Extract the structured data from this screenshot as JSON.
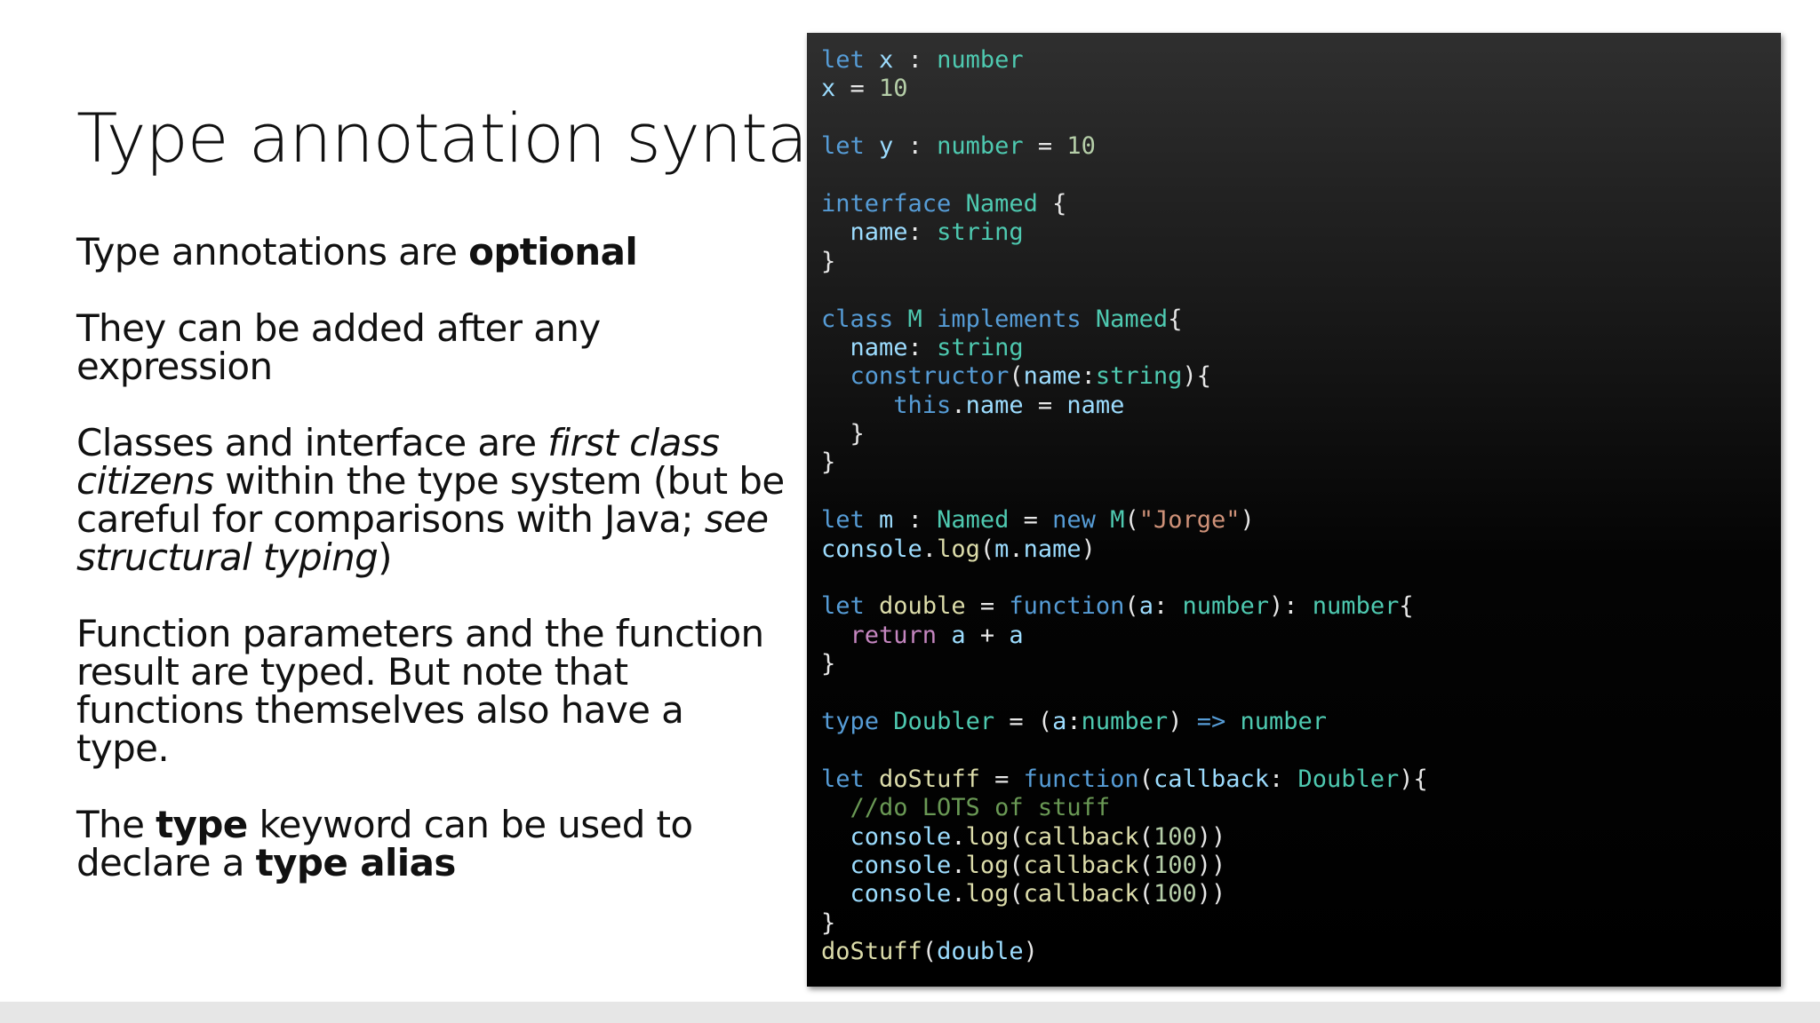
{
  "slide": {
    "title": "Type annotation syntax",
    "bullets": [
      [
        {
          "t": "Type annotations are "
        },
        {
          "t": "optional",
          "b": true
        }
      ],
      [
        {
          "t": "They can be added after any expression"
        }
      ],
      [
        {
          "t": "Classes and interface are "
        },
        {
          "t": "first class citizens",
          "i": true
        },
        {
          "t": " within the type system (but be careful for comparisons with Java; "
        },
        {
          "t": "see structural typing",
          "i": true
        },
        {
          "t": ")"
        }
      ],
      [
        {
          "t": "Function parameters and the function result are typed. But note that functions themselves also have a type."
        }
      ],
      [
        {
          "t": "The "
        },
        {
          "t": "type",
          "b": true
        },
        {
          "t": " keyword can be used to declare a "
        },
        {
          "t": "type alias",
          "b": true
        }
      ]
    ]
  },
  "code_lines": [
    [
      [
        "kw",
        "let"
      ],
      [
        "pl",
        " "
      ],
      [
        "id",
        "x"
      ],
      [
        "pl",
        " : "
      ],
      [
        "ty",
        "number"
      ]
    ],
    [
      [
        "id",
        "x"
      ],
      [
        "pl",
        " = "
      ],
      [
        "num",
        "10"
      ]
    ],
    [],
    [
      [
        "kw",
        "let"
      ],
      [
        "pl",
        " "
      ],
      [
        "id",
        "y"
      ],
      [
        "pl",
        " : "
      ],
      [
        "ty",
        "number"
      ],
      [
        "pl",
        " = "
      ],
      [
        "num",
        "10"
      ]
    ],
    [],
    [
      [
        "kw",
        "interface"
      ],
      [
        "pl",
        " "
      ],
      [
        "ty",
        "Named"
      ],
      [
        "pl",
        " {"
      ]
    ],
    [
      [
        "pl",
        "  "
      ],
      [
        "id",
        "name"
      ],
      [
        "pl",
        ": "
      ],
      [
        "ty",
        "string"
      ]
    ],
    [
      [
        "pl",
        "}"
      ]
    ],
    [],
    [
      [
        "kw",
        "class"
      ],
      [
        "pl",
        " "
      ],
      [
        "ty",
        "M"
      ],
      [
        "pl",
        " "
      ],
      [
        "kw",
        "implements"
      ],
      [
        "pl",
        " "
      ],
      [
        "ty",
        "Named"
      ],
      [
        "pl",
        "{"
      ]
    ],
    [
      [
        "pl",
        "  "
      ],
      [
        "id",
        "name"
      ],
      [
        "pl",
        ": "
      ],
      [
        "ty",
        "string"
      ]
    ],
    [
      [
        "pl",
        "  "
      ],
      [
        "kw",
        "constructor"
      ],
      [
        "pl",
        "("
      ],
      [
        "id",
        "name"
      ],
      [
        "pl",
        ":"
      ],
      [
        "ty",
        "string"
      ],
      [
        "pl",
        "){"
      ]
    ],
    [
      [
        "pl",
        "     "
      ],
      [
        "kw",
        "this"
      ],
      [
        "pl",
        "."
      ],
      [
        "id",
        "name"
      ],
      [
        "pl",
        " = "
      ],
      [
        "id",
        "name"
      ]
    ],
    [
      [
        "pl",
        "  }"
      ]
    ],
    [
      [
        "pl",
        "}"
      ]
    ],
    [],
    [
      [
        "kw",
        "let"
      ],
      [
        "pl",
        " "
      ],
      [
        "id",
        "m"
      ],
      [
        "pl",
        " : "
      ],
      [
        "ty",
        "Named"
      ],
      [
        "pl",
        " = "
      ],
      [
        "kw",
        "new"
      ],
      [
        "pl",
        " "
      ],
      [
        "ty",
        "M"
      ],
      [
        "pl",
        "("
      ],
      [
        "str",
        "\"Jorge\""
      ],
      [
        "pl",
        ")"
      ]
    ],
    [
      [
        "id",
        "console"
      ],
      [
        "pl",
        "."
      ],
      [
        "fn",
        "log"
      ],
      [
        "pl",
        "("
      ],
      [
        "id",
        "m"
      ],
      [
        "pl",
        "."
      ],
      [
        "id",
        "name"
      ],
      [
        "pl",
        ")"
      ]
    ],
    [],
    [
      [
        "kw",
        "let"
      ],
      [
        "pl",
        " "
      ],
      [
        "fn",
        "double"
      ],
      [
        "pl",
        " = "
      ],
      [
        "kw",
        "function"
      ],
      [
        "pl",
        "("
      ],
      [
        "id",
        "a"
      ],
      [
        "pl",
        ": "
      ],
      [
        "ty",
        "number"
      ],
      [
        "pl",
        "): "
      ],
      [
        "ty",
        "number"
      ],
      [
        "pl",
        "{"
      ]
    ],
    [
      [
        "pl",
        "  "
      ],
      [
        "ctl",
        "return"
      ],
      [
        "pl",
        " "
      ],
      [
        "id",
        "a"
      ],
      [
        "pl",
        " + "
      ],
      [
        "id",
        "a"
      ]
    ],
    [
      [
        "pl",
        "}"
      ]
    ],
    [],
    [
      [
        "kw",
        "type"
      ],
      [
        "pl",
        " "
      ],
      [
        "ty",
        "Doubler"
      ],
      [
        "pl",
        " = ("
      ],
      [
        "id",
        "a"
      ],
      [
        "pl",
        ":"
      ],
      [
        "ty",
        "number"
      ],
      [
        "pl",
        ") "
      ],
      [
        "kw",
        "=>"
      ],
      [
        "pl",
        " "
      ],
      [
        "ty",
        "number"
      ]
    ],
    [],
    [
      [
        "kw",
        "let"
      ],
      [
        "pl",
        " "
      ],
      [
        "fn",
        "doStuff"
      ],
      [
        "pl",
        " = "
      ],
      [
        "kw",
        "function"
      ],
      [
        "pl",
        "("
      ],
      [
        "id",
        "callback"
      ],
      [
        "pl",
        ": "
      ],
      [
        "ty",
        "Doubler"
      ],
      [
        "pl",
        "){"
      ]
    ],
    [
      [
        "pl",
        "  "
      ],
      [
        "cm",
        "//do LOTS of stuff"
      ]
    ],
    [
      [
        "pl",
        "  "
      ],
      [
        "id",
        "console"
      ],
      [
        "pl",
        "."
      ],
      [
        "fn",
        "log"
      ],
      [
        "pl",
        "("
      ],
      [
        "fn",
        "callback"
      ],
      [
        "pl",
        "("
      ],
      [
        "num",
        "100"
      ],
      [
        "pl",
        "))"
      ]
    ],
    [
      [
        "pl",
        "  "
      ],
      [
        "id",
        "console"
      ],
      [
        "pl",
        "."
      ],
      [
        "fn",
        "log"
      ],
      [
        "pl",
        "("
      ],
      [
        "fn",
        "callback"
      ],
      [
        "pl",
        "("
      ],
      [
        "num",
        "100"
      ],
      [
        "pl",
        "))"
      ]
    ],
    [
      [
        "pl",
        "  "
      ],
      [
        "id",
        "console"
      ],
      [
        "pl",
        "."
      ],
      [
        "fn",
        "log"
      ],
      [
        "pl",
        "("
      ],
      [
        "fn",
        "callback"
      ],
      [
        "pl",
        "("
      ],
      [
        "num",
        "100"
      ],
      [
        "pl",
        "))"
      ]
    ],
    [
      [
        "pl",
        "}"
      ]
    ],
    [
      [
        "fn",
        "doStuff"
      ],
      [
        "pl",
        "("
      ],
      [
        "id",
        "double"
      ],
      [
        "pl",
        ")"
      ]
    ]
  ],
  "code_colors": {
    "keyword": "#569cd6",
    "type": "#4ec9b0",
    "identifier": "#9cdcfe",
    "function": "#dcdcaa",
    "number": "#b5cea8",
    "string": "#ce9178",
    "comment": "#6a9955",
    "control": "#c586c0",
    "plain": "#e6e6e6"
  }
}
